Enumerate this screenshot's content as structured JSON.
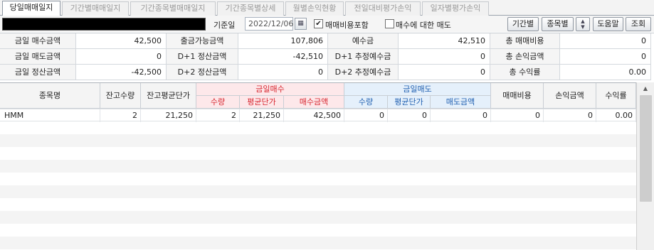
{
  "tabs": [
    "당일매매일지",
    "기간별매매일지",
    "기간종목별매매일지",
    "기간종목별상세",
    "월별손익현황",
    "전일대비평가손익",
    "일자별평가손익"
  ],
  "toolbar": {
    "date_label": "기준일",
    "date_value": "2022/12/06",
    "include_fee_label": "매매비용포함",
    "include_fee_checked": true,
    "sell_for_buy_label": "매수에 대한 매도",
    "sell_for_buy_checked": false,
    "buttons": {
      "period": "기간별",
      "by_stock": "종목별",
      "help": "도움말",
      "search": "조회"
    }
  },
  "summary": {
    "rows": [
      [
        {
          "label": "금일 매수금액",
          "value": "42,500"
        },
        {
          "label": "출금가능금액",
          "value": "107,806"
        },
        {
          "label": "예수금",
          "value": "42,510"
        },
        {
          "label": "총 매매비용",
          "value": "0"
        }
      ],
      [
        {
          "label": "금일 매도금액",
          "value": "0"
        },
        {
          "label": "D+1 정산금액",
          "value": "-42,510"
        },
        {
          "label": "D+1 추정예수금",
          "value": "0"
        },
        {
          "label": "총 손익금액",
          "value": "0"
        }
      ],
      [
        {
          "label": "금일 정산금액",
          "value": "-42,500"
        },
        {
          "label": "D+2 정산금액",
          "value": "0"
        },
        {
          "label": "D+2 추정예수금",
          "value": "0"
        },
        {
          "label": "총 수익률",
          "value": "0.00"
        }
      ]
    ]
  },
  "grid": {
    "headers": {
      "name": "종목명",
      "qty": "잔고수량",
      "avg": "잔고평균단가",
      "buy_group": "금일매수",
      "buy_qty": "수량",
      "buy_avg": "평균단가",
      "buy_amt": "매수금액",
      "sell_group": "금일매도",
      "sell_qty": "수량",
      "sell_avg": "평균단가",
      "sell_amt": "매도금액",
      "fee": "매매비용",
      "pnl": "손익금액",
      "rate": "수익률"
    },
    "rows": [
      {
        "name": "HMM",
        "qty": "2",
        "avg": "21,250",
        "buy_qty": "2",
        "buy_avg": "21,250",
        "buy_amt": "42,500",
        "sell_qty": "0",
        "sell_avg": "0",
        "sell_amt": "0",
        "fee": "0",
        "pnl": "0",
        "rate": "0.00"
      }
    ]
  },
  "colors": {
    "buy_header_bg": "#fde8ea",
    "buy_header_text": "#d7262f",
    "sell_header_bg": "#e5f0fb",
    "sell_header_text": "#1f5fb0"
  }
}
